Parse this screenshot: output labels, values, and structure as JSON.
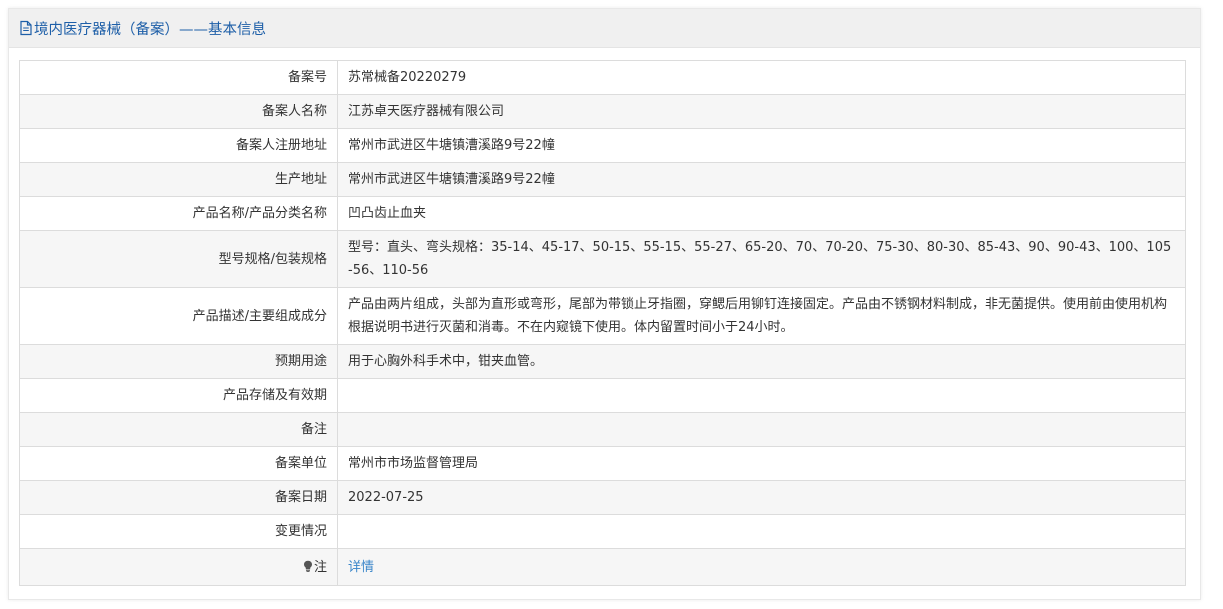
{
  "header": {
    "title": "境内医疗器械（备案）——基本信息",
    "icon": "document-icon"
  },
  "accent_color": "#1e5fa8",
  "link_color": "#3b86c9",
  "rows": [
    {
      "label": "备案号",
      "value": "苏常械备20220279"
    },
    {
      "label": "备案人名称",
      "value": "江苏卓天医疗器械有限公司"
    },
    {
      "label": "备案人注册地址",
      "value": "常州市武进区牛塘镇漕溪路9号22幢"
    },
    {
      "label": "生产地址",
      "value": "常州市武进区牛塘镇漕溪路9号22幢"
    },
    {
      "label": "产品名称/产品分类名称",
      "value": "凹凸齿止血夹"
    },
    {
      "label": "型号规格/包装规格",
      "value": "型号：直头、弯头规格：35-14、45-17、50-15、55-15、55-27、65-20、70、70-20、75-30、80-30、85-43、90、90-43、100、105-56、110-56"
    },
    {
      "label": "产品描述/主要组成成分",
      "value": "产品由两片组成，头部为直形或弯形，尾部为带锁止牙指圈，穿鳃后用铆钉连接固定。产品由不锈钢材料制成，非无菌提供。使用前由使用机构根据说明书进行灭菌和消毒。不在内窥镜下使用。体内留置时间小于24小时。"
    },
    {
      "label": "预期用途",
      "value": "用于心胸外科手术中，钳夹血管。"
    },
    {
      "label": "产品存储及有效期",
      "value": ""
    },
    {
      "label": "备注",
      "value": ""
    },
    {
      "label": "备案单位",
      "value": "常州市市场监督管理局"
    },
    {
      "label": "备案日期",
      "value": "2022-07-25"
    },
    {
      "label": "变更情况",
      "value": ""
    }
  ],
  "note": {
    "label": "注",
    "icon": "lightbulb-icon",
    "link_text": "详情"
  }
}
